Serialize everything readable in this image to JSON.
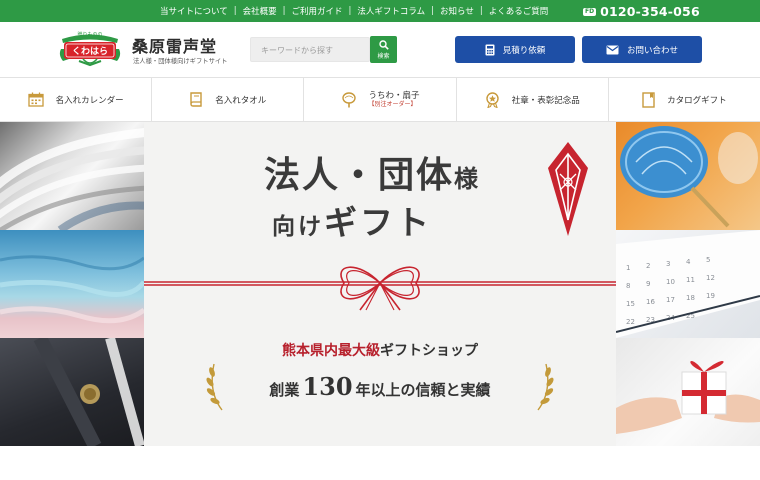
{
  "topbar": {
    "links": [
      "当サイトについて",
      "会社概要",
      "ご利用ガイド",
      "法人ギフトコラム",
      "お知らせ",
      "よくあるご質問"
    ],
    "freecall_badge": "FD",
    "phone": "0120-354-056",
    "bg_color": "#2e9a45"
  },
  "header": {
    "logo_text": "くわはら",
    "logo_ribbon_text": "贈りものの",
    "brand_name": "桑原雷声堂",
    "tagline": "法人様・団体様向けギフトサイト",
    "search_placeholder": "キーワードから探す",
    "search_button_label": "検索",
    "quote_button": "見積り依頼",
    "contact_button": "お問い合わせ",
    "button_color": "#1e4fa6"
  },
  "category_nav": [
    {
      "label": "名入れカレンダー",
      "icon": "calendar-icon"
    },
    {
      "label": "名入れタオル",
      "icon": "towel-book-icon"
    },
    {
      "label": "うちわ・扇子",
      "sublabel": "【別注オーダー】",
      "icon": "uchiwa-fan-icon"
    },
    {
      "label": "社章・表彰記念品",
      "icon": "medal-icon"
    },
    {
      "label": "カタログギフト",
      "icon": "catalog-icon"
    }
  ],
  "hero": {
    "title_line1_main": "法人・団体",
    "title_line1_small": "様",
    "title_line2_small": "向け",
    "title_line2_main": "ギフト",
    "sub1_red": "熊本県内最大級",
    "sub1_dark": "ギフトショップ",
    "sub2_pre": "創業",
    "sub2_number": "130",
    "sub2_post": "年以上の信頼と実績",
    "accent_red": "#c7242f"
  }
}
